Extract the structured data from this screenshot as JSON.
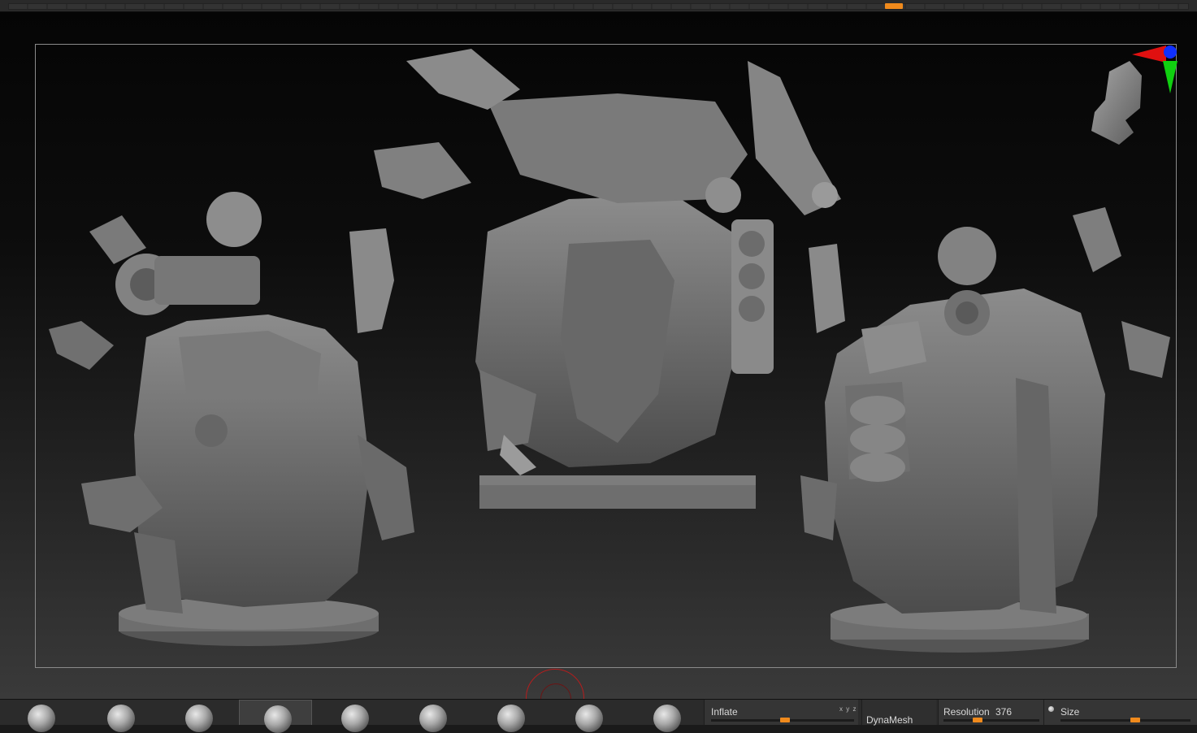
{
  "timeline": {
    "marker_color": "#f08a1c"
  },
  "canvas": {
    "gizmo": {
      "x_axis_color": "#e01010",
      "y_axis_color": "#10d010",
      "z_axis_color": "#1030ff"
    },
    "models": [
      "model-rear-view",
      "model-front-view",
      "model-side-view"
    ]
  },
  "brushes": [
    {
      "name": "brush-1"
    },
    {
      "name": "brush-2"
    },
    {
      "name": "brush-3"
    },
    {
      "name": "brush-4",
      "active": true
    },
    {
      "name": "brush-5"
    },
    {
      "name": "brush-6"
    },
    {
      "name": "brush-7"
    },
    {
      "name": "brush-8"
    },
    {
      "name": "brush-9"
    }
  ],
  "tool_panel": {
    "inflate_label": "Inflate",
    "xyz_icon": "x y z",
    "dynamesh_label": "DynaMesh",
    "resolution_label": "Resolution",
    "resolution_value": "376",
    "size_label": "Size"
  },
  "accent_color": "#f08a1c"
}
